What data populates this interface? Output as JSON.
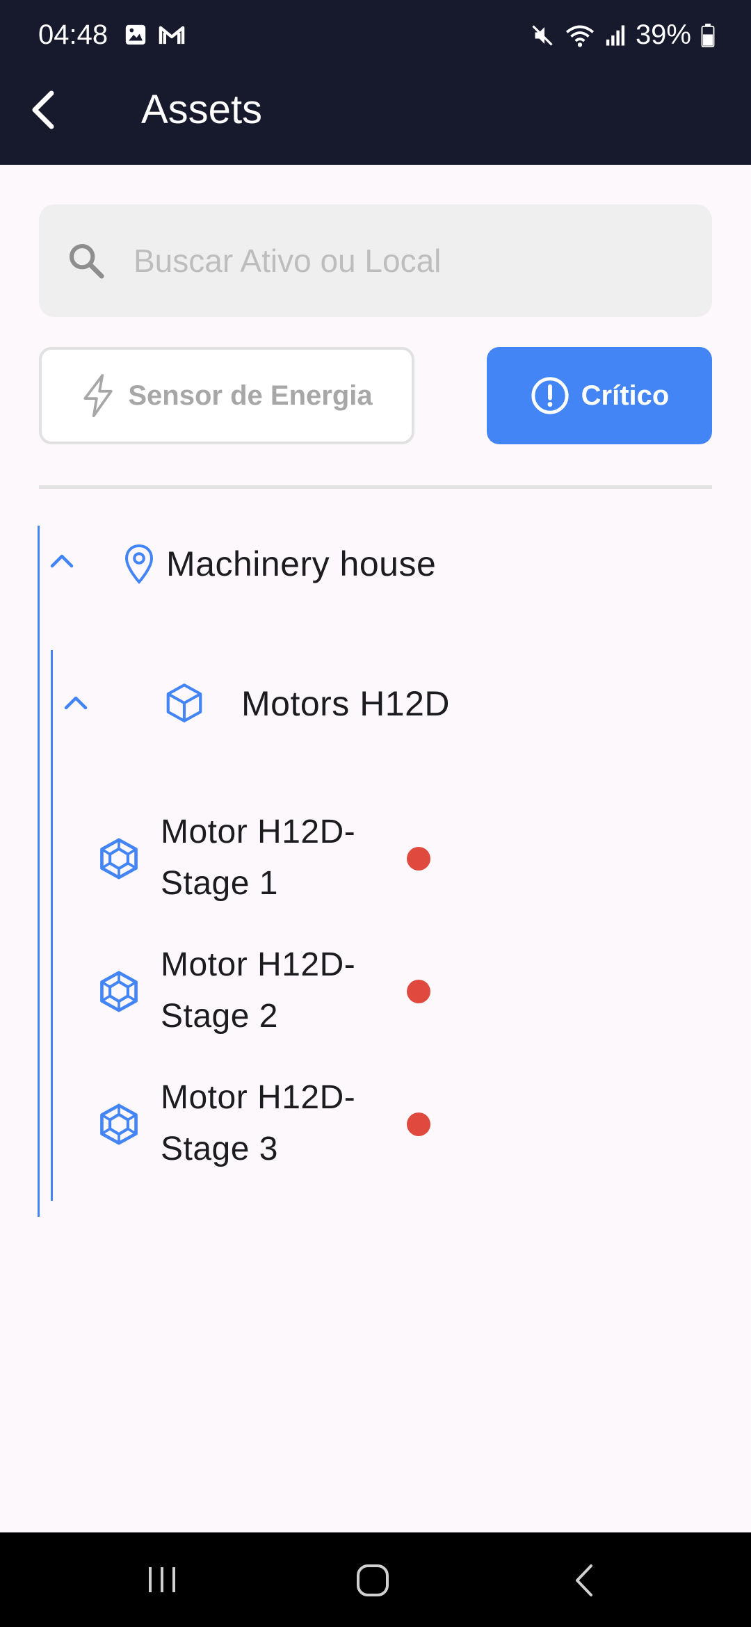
{
  "status_bar": {
    "time": "04:48",
    "battery": "39%",
    "icons": [
      "image-icon",
      "gmail-icon",
      "mute-icon",
      "wifi-icon",
      "signal-icon",
      "battery-icon"
    ]
  },
  "app_bar": {
    "title": "Assets",
    "back_icon": "arrow-back-icon"
  },
  "search": {
    "placeholder": "Buscar Ativo ou Local",
    "value": ""
  },
  "filters": {
    "sensor_label": "Sensor de Energia",
    "critico_label": "Crítico"
  },
  "tree": {
    "location": {
      "label": "Machinery house",
      "expanded": true
    },
    "asset": {
      "label": "Motors H12D",
      "expanded": true
    },
    "components": [
      {
        "label": "Motor H12D-Stage 1",
        "line1": "Motor H12D-",
        "line2": "Stage 1",
        "status": "critical"
      },
      {
        "label": "Motor H12D-Stage 2",
        "line1": "Motor H12D-",
        "line2": "Stage 2",
        "status": "critical"
      },
      {
        "label": "Motor H12D-Stage 3",
        "line1": "Motor H12D-",
        "line2": "Stage 3",
        "status": "critical"
      }
    ]
  },
  "colors": {
    "app_bar_bg": "#17192d",
    "accent": "#4385f5",
    "critical_dot": "#e0493e",
    "page_bg": "#fdf8fc"
  }
}
